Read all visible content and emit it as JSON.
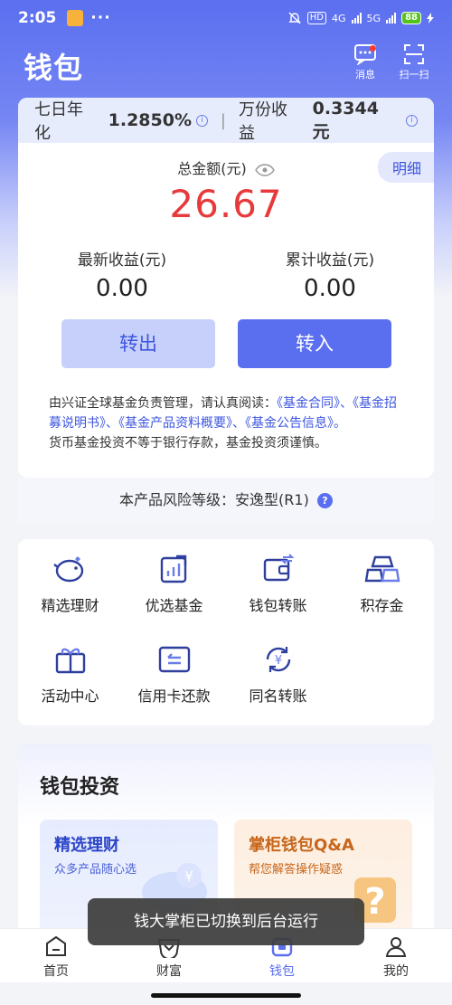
{
  "status_bar": {
    "time": "2:05",
    "more": "···",
    "hd": "HD",
    "net1": "4G",
    "net2": "5G",
    "battery": "88"
  },
  "header": {
    "title": "钱包",
    "message_label": "消息",
    "scan_label": "扫一扫"
  },
  "rates": {
    "seven_day_label": "七日年化",
    "seven_day_value": "1.2850%",
    "separator": "|",
    "per_10k_label": "万份收益",
    "per_10k_value": "0.3344 元"
  },
  "balance": {
    "detail_label": "明细",
    "total_label": "总金额(元)",
    "total_value": "26.67",
    "latest_label": "最新收益(元)",
    "latest_value": "0.00",
    "cumulative_label": "累计收益(元)",
    "cumulative_value": "0.00"
  },
  "actions": {
    "transfer_out": "转出",
    "transfer_in": "转入"
  },
  "disclaimer": {
    "prefix": "由兴证全球基金负责管理，请认真阅读：",
    "link1": "《基金合同》、",
    "link2": "《基金招募说明书》、",
    "link3": "《基金产品资料概要》、",
    "link4": "《基金公告信息》",
    "end_mark": "。",
    "line2": "货币基金投资不等于银行存款，基金投资须谨慎。"
  },
  "risk": {
    "label": "本产品风险等级：安逸型(R1)",
    "help": "?"
  },
  "services": [
    {
      "label": "精选理财",
      "icon": "piggy-bank-icon"
    },
    {
      "label": "优选基金",
      "icon": "chart-icon"
    },
    {
      "label": "钱包转账",
      "icon": "wallet-transfer-icon"
    },
    {
      "label": "积存金",
      "icon": "gold-bars-icon"
    },
    {
      "label": "活动中心",
      "icon": "gift-icon"
    },
    {
      "label": "信用卡还款",
      "icon": "credit-card-icon"
    },
    {
      "label": "同名转账",
      "icon": "yuan-cycle-icon"
    }
  ],
  "invest": {
    "title": "钱包投资",
    "promo1_title": "精选理财",
    "promo1_sub": "众多产品随心选",
    "promo2_title": "掌柜钱包Q&A",
    "promo2_sub": "帮您解答操作疑惑"
  },
  "toast": "钱大掌柜已切换到后台运行",
  "nav": [
    {
      "label": "首页"
    },
    {
      "label": "财富"
    },
    {
      "label": "钱包"
    },
    {
      "label": "我的"
    }
  ],
  "colors": {
    "accent": "#5a6ff0",
    "amount_red": "#e8393b",
    "promo_orange": "#c7661a"
  }
}
